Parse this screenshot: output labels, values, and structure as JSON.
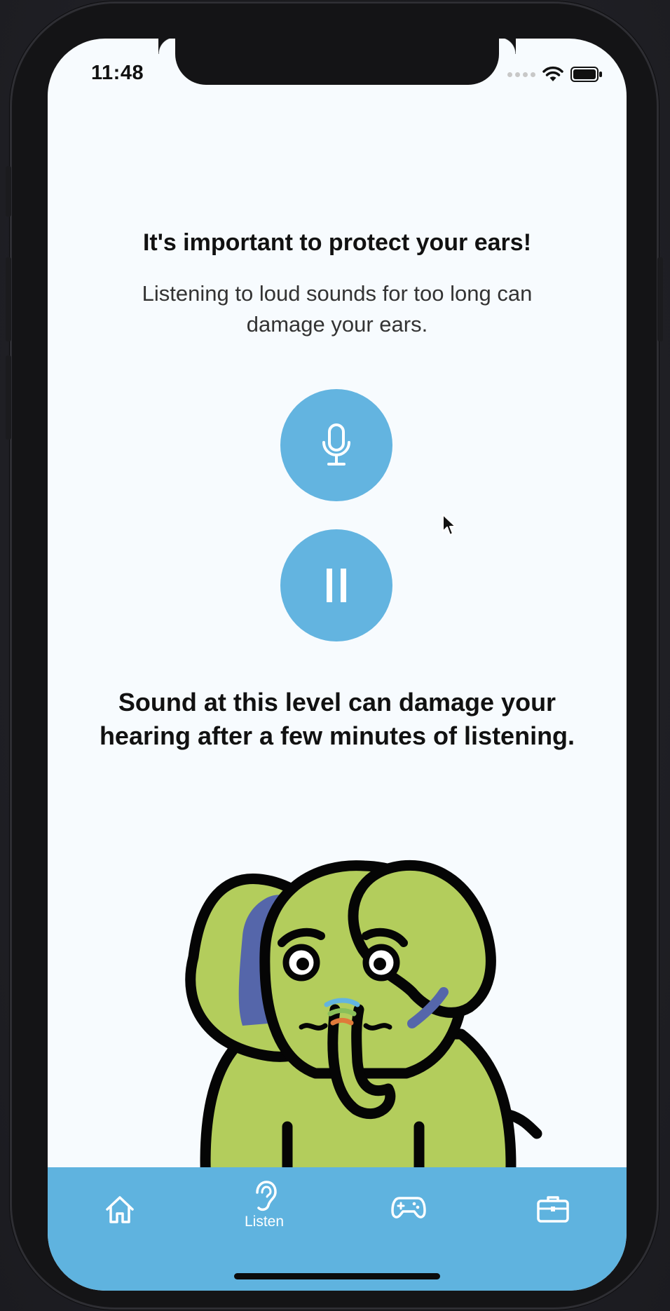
{
  "status_bar": {
    "time": "11:48"
  },
  "info": {
    "headline": "It's important to protect your ears!",
    "body": "Listening to loud sounds for too long can damage your ears."
  },
  "controls": {
    "mic_icon": "microphone-icon",
    "pause_icon": "pause-icon"
  },
  "warning": "Sound at this level can damage your hearing after a few minutes of listening.",
  "tabbar": {
    "tabs": [
      {
        "icon": "home-icon",
        "label": ""
      },
      {
        "icon": "ear-icon",
        "label": "Listen"
      },
      {
        "icon": "gamepad-icon",
        "label": ""
      },
      {
        "icon": "briefcase-icon",
        "label": ""
      }
    ]
  },
  "colors": {
    "accent": "#63b4e0",
    "tabbar": "#5fb3df",
    "mascot_body": "#b3cd5c",
    "mascot_ear": "#5566aa"
  }
}
